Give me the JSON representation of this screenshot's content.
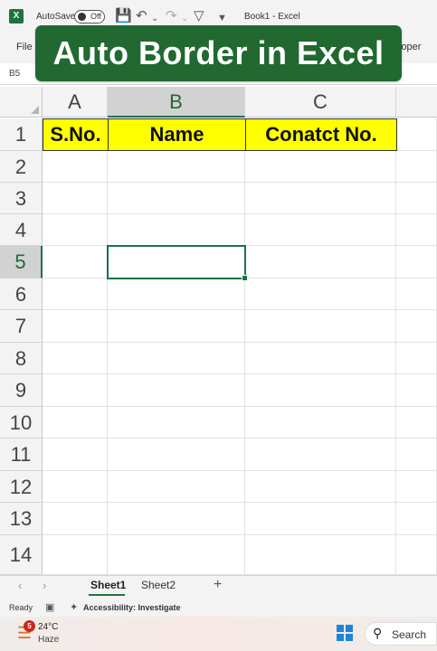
{
  "titlebar": {
    "app_icon": "X",
    "autosave_label": "AutoSave",
    "autosave_state": "Off",
    "doc_title": "Book1 - Excel",
    "icons": [
      "excel-logo-icon",
      "save-icon",
      "undo-icon",
      "redo-icon",
      "filter-icon",
      "customize-icon"
    ]
  },
  "ribbon": {
    "file_tab": "File",
    "developer_tab": "loper"
  },
  "banner": {
    "text": "Auto Border in Excel",
    "color": "#216930"
  },
  "formula_bar": {
    "name_box": "B5"
  },
  "grid": {
    "columns": [
      "A",
      "B",
      "C"
    ],
    "rows": [
      "1",
      "2",
      "3",
      "4",
      "5",
      "6",
      "7",
      "8",
      "9",
      "10",
      "11",
      "12",
      "13",
      "14"
    ],
    "selected_cell": "B5",
    "header_row": {
      "A1": "S.No.",
      "B1": "Name",
      "C1": "Conatct No."
    },
    "header_fill": "#ffff00"
  },
  "sheets": {
    "tabs": [
      "Sheet1",
      "Sheet2"
    ],
    "active": "Sheet1",
    "add_label": "+"
  },
  "status": {
    "ready": "Ready",
    "accessibility": "Accessibility: Investigate"
  },
  "taskbar": {
    "temperature": "24°C",
    "condition": "Haze",
    "badge": "5",
    "search_label": "Search"
  }
}
